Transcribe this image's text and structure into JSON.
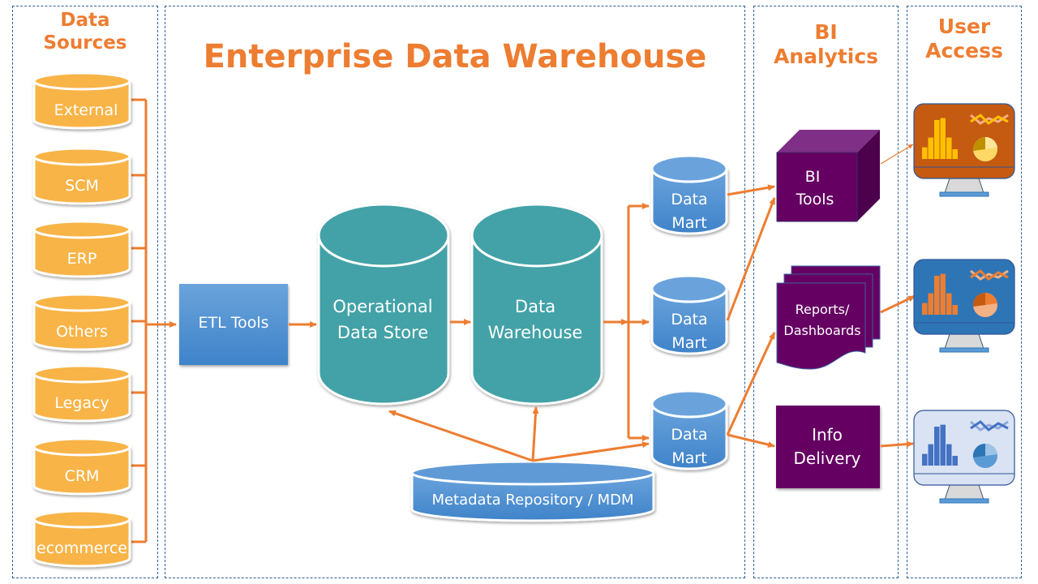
{
  "colors": {
    "accent": "#ed7d31",
    "source_db": "#f8b446",
    "teal_db": "#43a2a7",
    "blue_db": "#4a8cd0",
    "purple": "#650062",
    "panel_border": "#2e5f93"
  },
  "panels": {
    "data_sources": {
      "title_line1": "Data",
      "title_line2": "Sources"
    },
    "warehouse": {
      "title": "Enterprise Data Warehouse"
    },
    "bi_analytics": {
      "title_line1": "BI",
      "title_line2": "Analytics"
    },
    "user_access": {
      "title_line1": "User",
      "title_line2": "Access"
    }
  },
  "sources": [
    {
      "label": "External"
    },
    {
      "label": "SCM"
    },
    {
      "label": "ERP"
    },
    {
      "label": "Others"
    },
    {
      "label": "Legacy"
    },
    {
      "label": "CRM"
    },
    {
      "label": "ecommerce"
    }
  ],
  "etl": {
    "label": "ETL Tools"
  },
  "ods": {
    "line1": "Operational",
    "line2": "Data Store"
  },
  "dw": {
    "line1": "Data",
    "line2": "Warehouse"
  },
  "marts": [
    {
      "line1": "Data",
      "line2": "Mart"
    },
    {
      "line1": "Data",
      "line2": "Mart"
    },
    {
      "line1": "Data",
      "line2": "Mart"
    }
  ],
  "metadata": {
    "label": "Metadata Repository / MDM"
  },
  "bi": {
    "tools": {
      "line1": "BI",
      "line2": "Tools"
    },
    "reports": {
      "line1": "Reports/",
      "line2": "Dashboards"
    },
    "delivery": {
      "line1": "Info",
      "line2": "Delivery"
    }
  },
  "monitors": [
    {
      "name": "orange-dashboard",
      "screen": "#c55a11",
      "bars": "#ffc000"
    },
    {
      "name": "blue-dashboard",
      "screen": "#2e75b6",
      "bars": "#ed7d31"
    },
    {
      "name": "light-dashboard",
      "screen": "#dae3f3",
      "bars": "#4472c4"
    }
  ]
}
